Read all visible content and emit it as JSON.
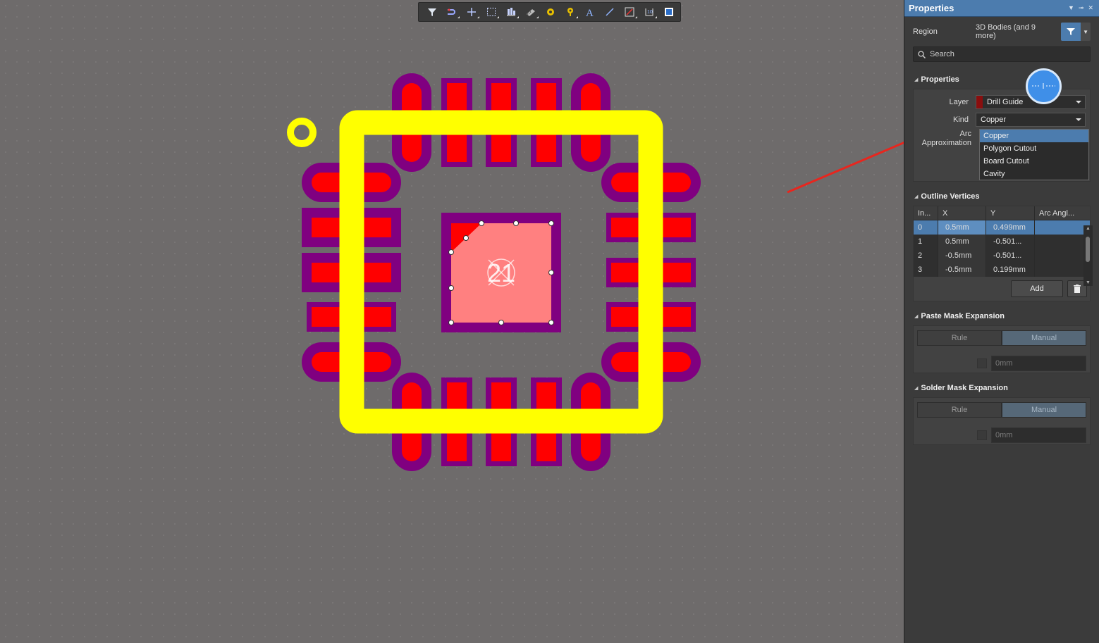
{
  "toolbar": {
    "tools": [
      "filter-icon",
      "route-icon",
      "cross-icon",
      "select-rect-icon",
      "align-icon",
      "component-icon",
      "pad-icon",
      "via-icon",
      "text-icon",
      "line-icon",
      "region-icon",
      "dimension-icon",
      "board-icon"
    ]
  },
  "pcb": {
    "center_label": "21",
    "colors": {
      "silkscreen": "#ffff00",
      "pad": "#ff0000",
      "mask": "#800080",
      "region": "#ff8080",
      "background": "#6e6b6b"
    }
  },
  "panel": {
    "title": "Properties",
    "object_type": "Region",
    "filter_summary": "3D Bodies (and 9 more)",
    "search_placeholder": "Search",
    "sections": {
      "properties": {
        "title": "Properties",
        "layer_label": "Layer",
        "layer_value": "Drill Guide",
        "kind_label": "Kind",
        "kind_value": "Copper",
        "arc_label_1": "Arc",
        "arc_label_2": "Approximation",
        "kind_options": [
          "Copper",
          "Polygon Cutout",
          "Board Cutout",
          "Cavity"
        ]
      },
      "vertices": {
        "title": "Outline Vertices",
        "headers": [
          "In...",
          "X",
          "Y",
          "Arc Angl..."
        ],
        "rows": [
          [
            "0",
            "0.5mm",
            "0.499mm",
            ""
          ],
          [
            "1",
            "0.5mm",
            "-0.501...",
            ""
          ],
          [
            "2",
            "-0.5mm",
            "-0.501...",
            ""
          ],
          [
            "3",
            "-0.5mm",
            "0.199mm",
            ""
          ]
        ],
        "add_label": "Add"
      },
      "paste": {
        "title": "Paste Mask Expansion",
        "rule_label": "Rule",
        "manual_label": "Manual",
        "value": "0mm"
      },
      "solder": {
        "title": "Solder Mask Expansion",
        "rule_label": "Rule",
        "manual_label": "Manual",
        "value": "0mm"
      }
    }
  }
}
